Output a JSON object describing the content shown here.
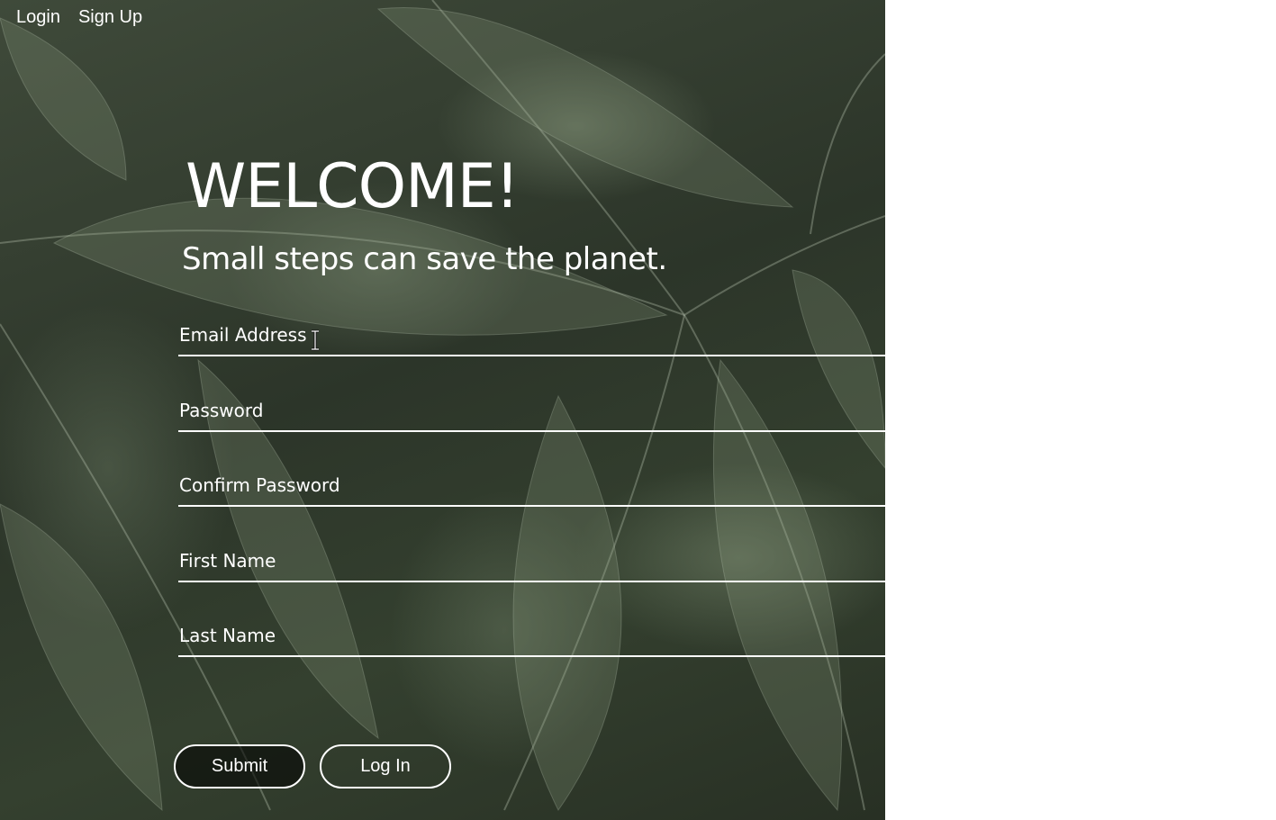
{
  "nav": {
    "login_label": "Login",
    "signup_label": "Sign Up"
  },
  "hero": {
    "title": "WELCOME!",
    "subtitle": "Small steps can save the planet."
  },
  "form": {
    "fields": [
      {
        "label": "Email Address",
        "value": ""
      },
      {
        "label": "Password",
        "value": ""
      },
      {
        "label": "Confirm Password",
        "value": ""
      },
      {
        "label": "First Name",
        "value": ""
      },
      {
        "label": "Last Name",
        "value": ""
      }
    ],
    "submit_label": "Submit",
    "login_label": "Log In"
  },
  "colors": {
    "text": "#ffffff",
    "background_right": "#ffffff",
    "leaf_dark": "#2c3529"
  },
  "icons": {
    "cursor": "text-cursor-icon"
  }
}
